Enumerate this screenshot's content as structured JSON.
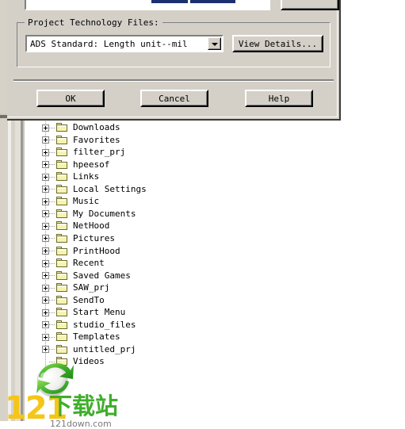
{
  "dialog": {
    "top_group": {
      "field_value": "",
      "button_label": ""
    },
    "tech_group": {
      "title": "Project Technology Files:",
      "combo_value": "ADS Standard: Length unit--mil",
      "combo_arrow_icon": "chevron-down-icon",
      "view_details_label": "View Details..."
    },
    "footer": {
      "ok_label": "OK",
      "cancel_label": "Cancel",
      "help_label": "Help"
    },
    "colors": {
      "face": "#d4d0c8",
      "selection": "#1c3070",
      "shadow": "#808080",
      "highlight": "#ffffff"
    }
  },
  "file_tree": {
    "expander_icon": "plus-box-icon",
    "folder_icon": "folder-icon",
    "items": [
      {
        "label": "Downloads",
        "expandable": true
      },
      {
        "label": "Favorites",
        "expandable": true
      },
      {
        "label": "filter_prj",
        "expandable": true
      },
      {
        "label": "hpeesof",
        "expandable": true
      },
      {
        "label": "Links",
        "expandable": true
      },
      {
        "label": "Local Settings",
        "expandable": true
      },
      {
        "label": "Music",
        "expandable": true
      },
      {
        "label": "My Documents",
        "expandable": true
      },
      {
        "label": "NetHood",
        "expandable": true
      },
      {
        "label": "Pictures",
        "expandable": true
      },
      {
        "label": "PrintHood",
        "expandable": true
      },
      {
        "label": "Recent",
        "expandable": true
      },
      {
        "label": "Saved Games",
        "expandable": true
      },
      {
        "label": "SAW_prj",
        "expandable": true
      },
      {
        "label": "SendTo",
        "expandable": true
      },
      {
        "label": "Start Menu",
        "expandable": true
      },
      {
        "label": "studio_files",
        "expandable": true
      },
      {
        "label": "Templates",
        "expandable": true
      },
      {
        "label": "untitled_prj",
        "expandable": true
      },
      {
        "label": "Videos",
        "expandable": false
      }
    ]
  },
  "watermark": {
    "number": "121",
    "cn_text": "下载站",
    "url": "121down.com",
    "logo_icon": "globe-arrow-logo-icon",
    "number_color": "#f5c518",
    "cn_color": "#3fae2a"
  }
}
